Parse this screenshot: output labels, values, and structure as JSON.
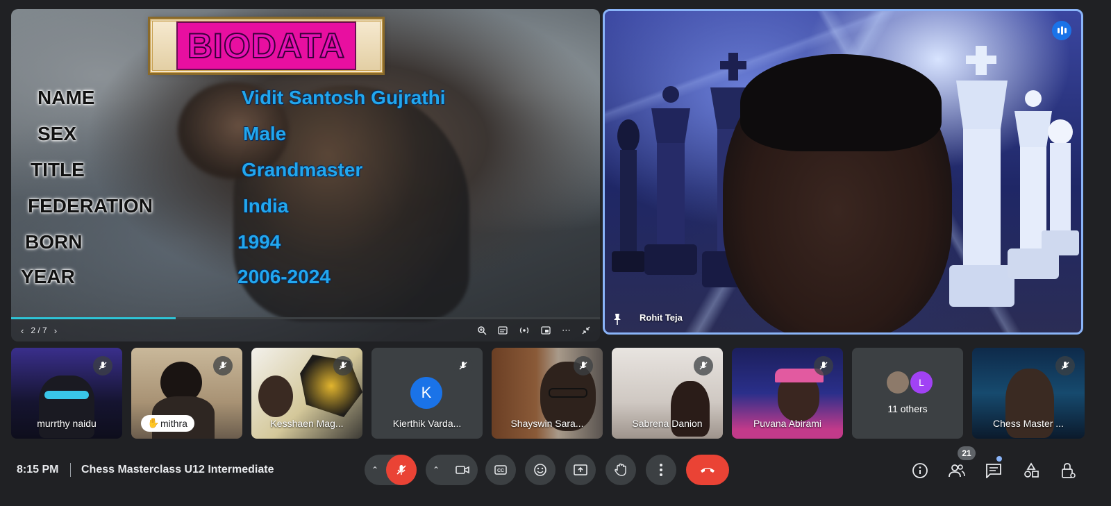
{
  "presentation": {
    "banner_title": "BIODATA",
    "fields": [
      {
        "label": "NAME",
        "value": "Vidit Santosh Gujrathi"
      },
      {
        "label": "SEX",
        "value": "Male"
      },
      {
        "label": "TITLE",
        "value": "Grandmaster"
      },
      {
        "label": "FEDERATION",
        "value": "India"
      },
      {
        "label": "BORN",
        "value": "1994"
      },
      {
        "label": "YEAR",
        "value": "2006-2024"
      }
    ],
    "page_indicator": "2 / 7",
    "progress_fraction": 0.28,
    "controls": [
      "zoom-icon",
      "captions-icon",
      "cast-icon",
      "pip-icon",
      "more-icon",
      "collapse-icon"
    ]
  },
  "speaker": {
    "name": "Rohit Teja",
    "accent": "#8ab4f8"
  },
  "participants": [
    {
      "name": "murrthy naidu",
      "muted": true
    },
    {
      "name": "mithra",
      "muted": true,
      "hand_raised": true
    },
    {
      "name": "Kesshaen Mag...",
      "muted": true
    },
    {
      "name": "Kierthik Varda...",
      "muted": true,
      "avatar_letter": "K",
      "avatar_color": "#1a73e8"
    },
    {
      "name": "Shayswin Sara...",
      "muted": true
    },
    {
      "name": "Sabrena Danion",
      "muted": true
    },
    {
      "name": "Puvana Abirami",
      "muted": true
    },
    {
      "name": "Chess Master ...",
      "muted": true
    }
  ],
  "others": {
    "label": "11 others",
    "avatar_letter": "L",
    "avatar_color": "#a142f4"
  },
  "bottombar": {
    "time": "8:15 PM",
    "meeting_title": "Chess Masterclass U12 Intermediate",
    "participant_count": "21",
    "colors": {
      "end_call": "#ea4335",
      "control_bg": "#3c4043"
    }
  }
}
